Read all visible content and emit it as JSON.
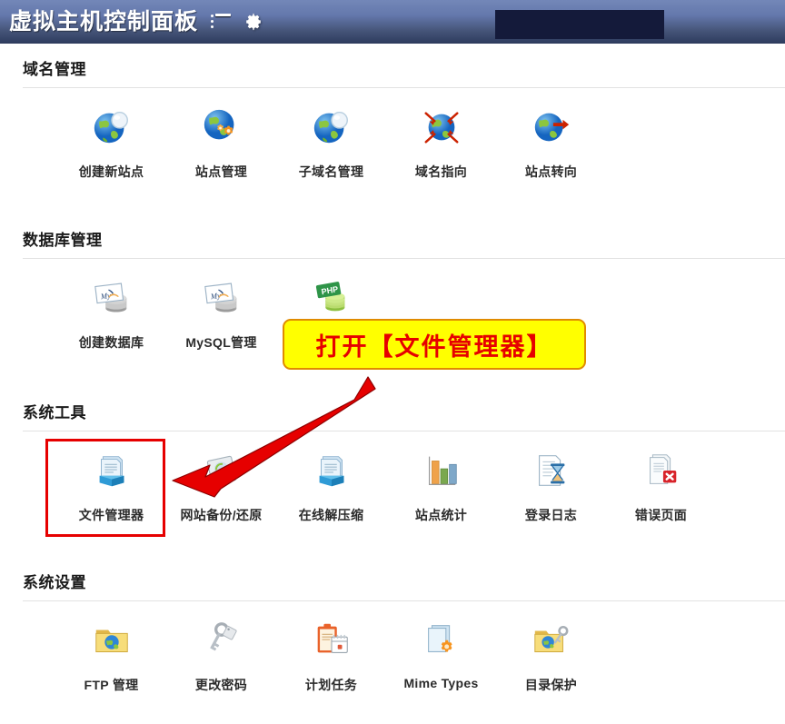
{
  "header": {
    "title": "虚拟主机控制面板",
    "menu_icon": "list-icon",
    "settings_icon": "gear-icon",
    "redacted_field": "",
    "gradient_top": "#7387b8",
    "gradient_bottom": "#2d3b5d",
    "redacted_color": "#141a3a"
  },
  "annotation": {
    "callout_text": "打开【文件管理器】",
    "callout_bg": "#ffff00",
    "callout_border": "#e08b00",
    "callout_text_color": "#e60000",
    "arrow_color": "#e60000",
    "highlight_color": "#e60000",
    "highlight_target": "文件管理器"
  },
  "sections": [
    {
      "title": "域名管理",
      "tiles": [
        {
          "label": "创建新站点",
          "icon": "globe-new-site-icon"
        },
        {
          "label": "站点管理",
          "icon": "globe-gear-icon"
        },
        {
          "label": "子域名管理",
          "icon": "globe-new-site-icon"
        },
        {
          "label": "域名指向",
          "icon": "globe-arrows-inward-icon"
        },
        {
          "label": "站点转向",
          "icon": "globe-arrow-right-icon"
        }
      ]
    },
    {
      "title": "数据库管理",
      "tiles": [
        {
          "label": "创建数据库",
          "icon": "mysql-database-icon"
        },
        {
          "label": "MySQL管理",
          "icon": "mysql-database-icon"
        },
        {
          "label": "",
          "icon": "php-database-icon"
        }
      ]
    },
    {
      "title": "系统工具",
      "tiles": [
        {
          "label": "文件管理器",
          "icon": "file-manager-icon"
        },
        {
          "label": "网站备份/还原",
          "icon": "backup-restore-icon"
        },
        {
          "label": "在线解压缩",
          "icon": "file-manager-icon"
        },
        {
          "label": "站点统计",
          "icon": "bar-chart-icon"
        },
        {
          "label": "登录日志",
          "icon": "document-hourglass-icon"
        },
        {
          "label": "错误页面",
          "icon": "document-error-icon"
        }
      ]
    },
    {
      "title": "系统设置",
      "tiles": [
        {
          "label": "FTP 管理",
          "icon": "folder-globe-icon"
        },
        {
          "label": "更改密码",
          "icon": "keys-icon"
        },
        {
          "label": "计划任务",
          "icon": "clipboard-calendar-icon"
        },
        {
          "label": "Mime Types",
          "icon": "document-gear-icon"
        },
        {
          "label": "目录保护",
          "icon": "folder-globe-key-icon"
        }
      ]
    }
  ]
}
